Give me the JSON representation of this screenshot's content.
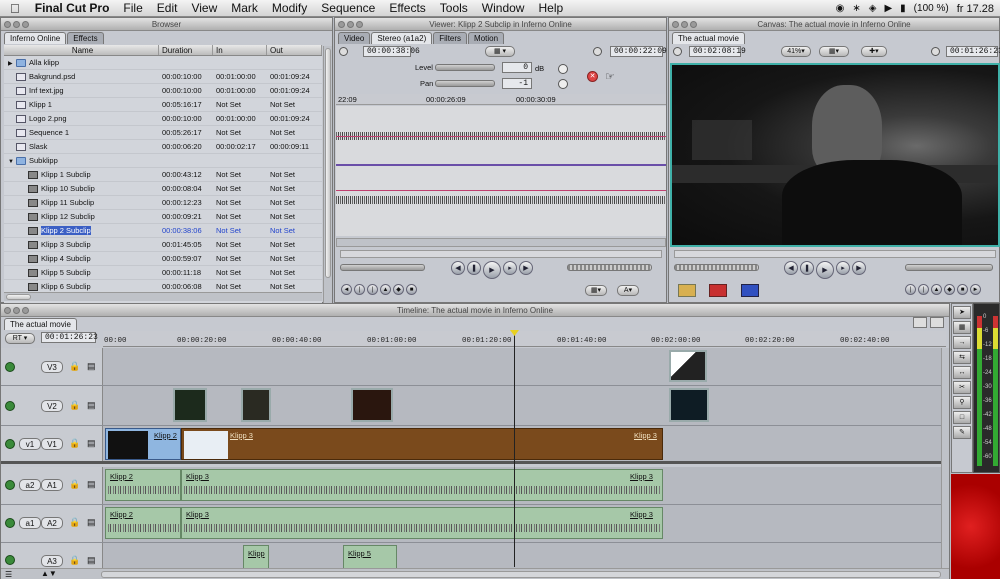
{
  "menubar": {
    "apple": "",
    "app_name": "Final Cut Pro",
    "items": [
      "File",
      "Edit",
      "View",
      "Mark",
      "Modify",
      "Sequence",
      "Effects",
      "Tools",
      "Window",
      "Help"
    ],
    "battery": "(100 %)",
    "clock": "fr 17.28"
  },
  "browser": {
    "title": "Browser",
    "tabs": [
      "Inferno Online",
      "Effects"
    ],
    "columns": [
      "Name",
      "Duration",
      "In",
      "Out"
    ],
    "rows": [
      {
        "name": "Alla klipp",
        "duration": "",
        "in": "",
        "out": "",
        "type": "folder",
        "indent": 0
      },
      {
        "name": "Bakgrund.psd",
        "duration": "00:00:10:00",
        "in": "00:01:00:00",
        "out": "00:01:09:24",
        "type": "file",
        "indent": 0
      },
      {
        "name": "Inf text.jpg",
        "duration": "00:00:10:00",
        "in": "00:01:00:00",
        "out": "00:01:09:24",
        "type": "file",
        "indent": 0
      },
      {
        "name": "Klipp 1",
        "duration": "00:05:16:17",
        "in": "Not Set",
        "out": "Not Set",
        "type": "file",
        "indent": 0
      },
      {
        "name": "Logo 2.png",
        "duration": "00:00:10:00",
        "in": "00:01:00:00",
        "out": "00:01:09:24",
        "type": "file",
        "indent": 0
      },
      {
        "name": "Sequence 1",
        "duration": "00:05:26:17",
        "in": "Not Set",
        "out": "Not Set",
        "type": "seq",
        "indent": 0
      },
      {
        "name": "Slask",
        "duration": "00:00:06:20",
        "in": "00:00:02:17",
        "out": "00:00:09:11",
        "type": "file",
        "indent": 0
      },
      {
        "name": "Subklipp",
        "duration": "",
        "in": "",
        "out": "",
        "type": "folder",
        "indent": 0
      },
      {
        "name": "Klipp 1 Subclip",
        "duration": "00:00:43:12",
        "in": "Not Set",
        "out": "Not Set",
        "type": "clip",
        "indent": 1
      },
      {
        "name": "Klipp 10 Subclip",
        "duration": "00:00:08:04",
        "in": "Not Set",
        "out": "Not Set",
        "type": "clip",
        "indent": 1
      },
      {
        "name": "Klipp 11 Subclip",
        "duration": "00:00:12:23",
        "in": "Not Set",
        "out": "Not Set",
        "type": "clip",
        "indent": 1
      },
      {
        "name": "Klipp 12 Subclip",
        "duration": "00:00:09:21",
        "in": "Not Set",
        "out": "Not Set",
        "type": "clip",
        "indent": 1
      },
      {
        "name": "Klipp 2 Subclip",
        "duration": "00:00:38:06",
        "in": "Not Set",
        "out": "Not Set",
        "type": "clip",
        "indent": 1,
        "selected": true
      },
      {
        "name": "Klipp 3 Subclip",
        "duration": "00:01:45:05",
        "in": "Not Set",
        "out": "Not Set",
        "type": "clip",
        "indent": 1
      },
      {
        "name": "Klipp 4 Subclip",
        "duration": "00:00:59:07",
        "in": "Not Set",
        "out": "Not Set",
        "type": "clip",
        "indent": 1
      },
      {
        "name": "Klipp 5 Subclip",
        "duration": "00:00:11:18",
        "in": "Not Set",
        "out": "Not Set",
        "type": "clip",
        "indent": 1
      },
      {
        "name": "Klipp 6 Subclip",
        "duration": "00:00:06:08",
        "in": "Not Set",
        "out": "Not Set",
        "type": "clip",
        "indent": 1
      }
    ]
  },
  "viewer": {
    "title": "Viewer: Klipp 2 Subclip in Inferno Online",
    "tabs": [
      "Video",
      "Stereo (a1a2)",
      "Filters",
      "Motion"
    ],
    "duration_tc": "00:00:38:06",
    "current_tc": "00:00:22:09",
    "level_label": "Level",
    "level_value": "0",
    "level_unit": "dB",
    "pan_label": "Pan",
    "pan_value": "-1",
    "ruler": [
      "22:09",
      "00:00:26:09",
      "00:00:30:09"
    ]
  },
  "canvas": {
    "title": "Canvas: The actual movie in Inferno Online",
    "tab": "The actual movie",
    "duration_tc": "00:02:08:19",
    "zoom": "41%",
    "current_tc": "00:01:26:23"
  },
  "timeline": {
    "title": "Timeline: The actual movie in Inferno Online",
    "tab": "The actual movie",
    "rt": "RT",
    "current_tc": "00:01:26:23",
    "ruler": [
      "00:00",
      "00:00:20:00",
      "00:00:40:00",
      "00:01:00:00",
      "00:01:20:00",
      "00:01:40:00",
      "00:02:00:00",
      "00:02:20:00",
      "00:02:40:00"
    ],
    "video_tracks": [
      "V3",
      "V2",
      "V1"
    ],
    "v1_src": "v1",
    "audio_tracks": [
      "A1",
      "A2",
      "A3"
    ],
    "audio_src": [
      "a2",
      "a1",
      ""
    ],
    "clips": {
      "v1_a": "Klipp 2",
      "v1_b": "Klipp 3",
      "v1_end": "Klipp 3",
      "a1_a": "Klipp 2",
      "a1_b": "Klipp 3",
      "a1_end": "Klipp 3",
      "a2_a": "Klipp 2",
      "a2_b": "Klipp 3",
      "a2_end": "Klipp 3",
      "a3_a": "Klipp",
      "a3_b": "Klipp 5"
    }
  },
  "meters": [
    "0",
    "-6",
    "-12",
    "-18",
    "-24",
    "-30",
    "-36",
    "-42",
    "-48",
    "-54",
    "-60"
  ]
}
